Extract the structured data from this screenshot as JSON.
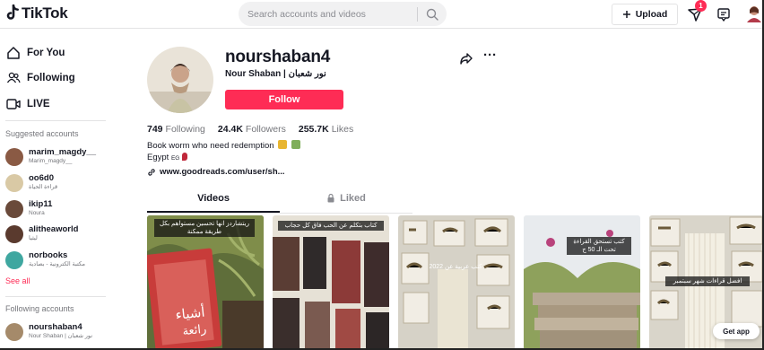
{
  "header": {
    "logo_text": "TikTok",
    "search_placeholder": "Search accounts and videos",
    "upload_label": "Upload",
    "inbox_badge": "1"
  },
  "sidebar": {
    "nav": [
      {
        "label": "For You",
        "icon": "home-icon"
      },
      {
        "label": "Following",
        "icon": "users-icon"
      },
      {
        "label": "LIVE",
        "icon": "live-icon"
      }
    ],
    "suggested_title": "Suggested accounts",
    "suggested": [
      {
        "name": "marim_magdy__",
        "sub": "Marim_magdy__",
        "color": "#8a5a44"
      },
      {
        "name": "oo6d0",
        "sub": "قراءة الحياة",
        "color": "#d9c9a5"
      },
      {
        "name": "ikip11",
        "sub": "Noura",
        "color": "#6a4a3a"
      },
      {
        "name": "alitheaworld",
        "sub": "ليثيا",
        "color": "#5a3a2e"
      },
      {
        "name": "norbooks",
        "sub": "مكتبة الكترونية - بصادية",
        "color": "#3fa7a0"
      }
    ],
    "see_all": "See all",
    "following_title": "Following accounts",
    "following": [
      {
        "name": "nourshaban4",
        "sub": "Nour Shaban | نور شعبان",
        "color": "#a58a6a"
      }
    ]
  },
  "profile": {
    "username": "nourshaban4",
    "nickname": "Nour Shaban | نور شعبان",
    "follow_label": "Follow",
    "stats": [
      {
        "value": "749",
        "label": "Following"
      },
      {
        "value": "24.4K",
        "label": "Followers"
      },
      {
        "value": "255.7K",
        "label": "Likes"
      }
    ],
    "bio_line1": "Book worm who need redemption",
    "bio_line2": "Egypt",
    "country_code": "EG",
    "link": "www.goodreads.com/user/sh..."
  },
  "tabs": {
    "videos": "Videos",
    "liked": "Liked"
  },
  "videos": [
    {
      "caption": "ريتشاردز انها تحسين مستواهم بكل طريقة ممكنة"
    },
    {
      "caption": "كتاب بتكلم عن الحب فاق كل حجاب"
    },
    {
      "caption": "كتب عربية عن 2022"
    },
    {
      "caption": "كتب تستحق القراءة تحت الـ 50 ج"
    },
    {
      "caption": "افضل قراءات شهر سبتمبر"
    }
  ],
  "get_app_label": "Get app",
  "colors": {
    "accent": "#fe2c55",
    "text": "#161823",
    "muted": "#75767b"
  }
}
